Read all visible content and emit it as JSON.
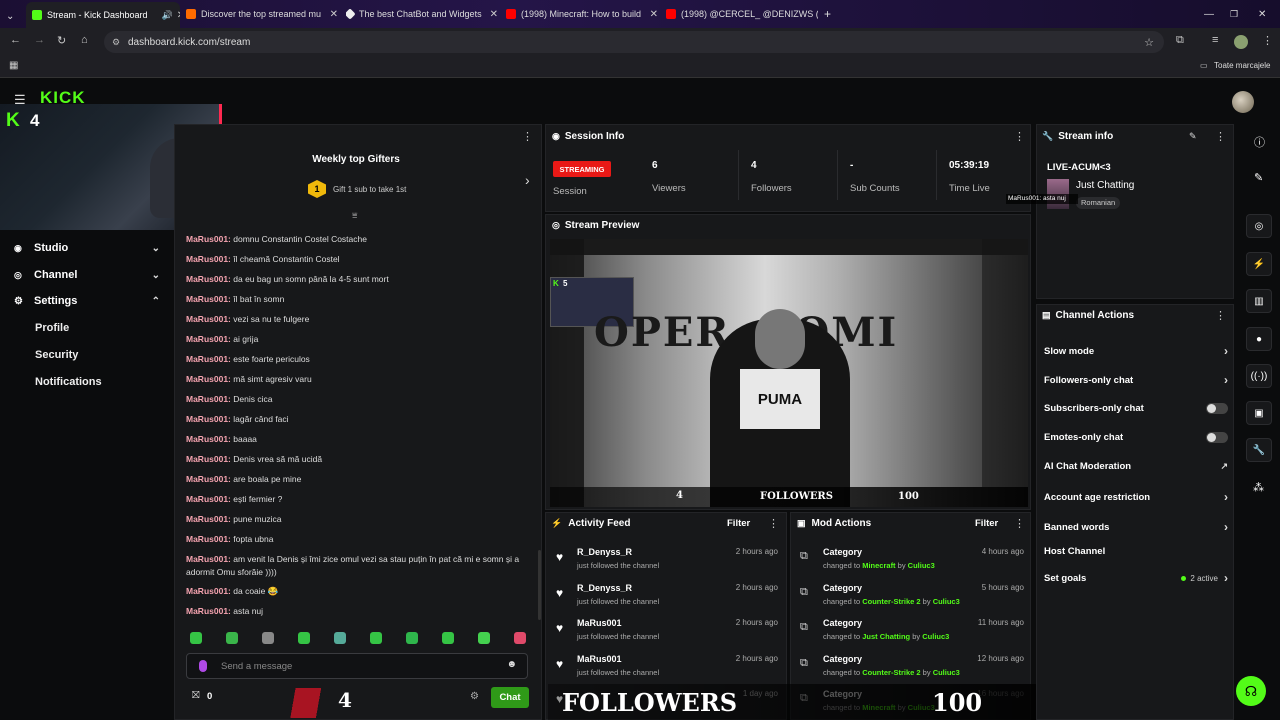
{
  "browser": {
    "tabs": [
      {
        "title": "Stream - Kick Dashboard",
        "color": "#53fc18",
        "active": true
      },
      {
        "title": "Discover the top streamed mu",
        "color": "#ff6a00"
      },
      {
        "title": "The best ChatBot and Widgets",
        "color": "#ffffff"
      },
      {
        "title": "(1998) Minecraft: How to build",
        "color": "#ff0000"
      },
      {
        "title": "(1998) @CERCEL_ @DENIZWS (",
        "color": "#ff0000"
      }
    ],
    "url": "dashboard.kick.com/stream",
    "bookmarks_label": "Toate marcajele"
  },
  "webcam": {
    "badge": "4"
  },
  "sidebar": {
    "items": [
      {
        "label": "Studio",
        "icon": "studio-icon"
      },
      {
        "label": "Channel",
        "icon": "channel-icon"
      },
      {
        "label": "Settings",
        "icon": "gear-icon"
      }
    ],
    "sub_items": [
      "Profile",
      "Security",
      "Notifications"
    ]
  },
  "chat": {
    "gifters_title": "Weekly top Gifters",
    "gifters_rank": "1",
    "gifters_text": "Gift 1 sub to take 1st",
    "messages": [
      {
        "user": "MaRus001:",
        "text": "domnu Constantin Costel Costache"
      },
      {
        "user": "MaRus001:",
        "text": "îl cheamă Constantin Costel"
      },
      {
        "user": "MaRus001:",
        "text": "da eu bag un somn până la 4-5 sunt mort"
      },
      {
        "user": "MaRus001:",
        "text": "îl bat în somn"
      },
      {
        "user": "MaRus001:",
        "text": "vezi sa nu te fulgere"
      },
      {
        "user": "MaRus001:",
        "text": "ai grija"
      },
      {
        "user": "MaRus001:",
        "text": "este foarte periculos"
      },
      {
        "user": "MaRus001:",
        "text": "mă simt agresiv varu"
      },
      {
        "user": "MaRus001:",
        "text": "Denis cica"
      },
      {
        "user": "MaRus001:",
        "text": "lagăr când faci"
      },
      {
        "user": "MaRus001:",
        "text": "baaaa"
      },
      {
        "user": "MaRus001:",
        "text": "Denis vrea să mă ucidă"
      },
      {
        "user": "MaRus001:",
        "text": "are boala pe mine"
      },
      {
        "user": "MaRus001:",
        "text": "ești fermier ?"
      },
      {
        "user": "MaRus001:",
        "text": "pune muzica"
      },
      {
        "user": "MaRus001:",
        "text": "fopta ubna"
      },
      {
        "user": "MaRus001:",
        "text": "am venit la Denis și îmi zice omul vezi sa stau puțin în pat că mi e somn și a adormit Omu sforăie ))))"
      },
      {
        "user": "MaRus001:",
        "text": "da coaie 😂"
      },
      {
        "user": "MaRus001:",
        "text": "asta nuj"
      }
    ],
    "input_placeholder": "Send a message",
    "points": "0",
    "chat_button": "Chat",
    "overlay_count": "4"
  },
  "session": {
    "title": "Session Info",
    "status_badge": "STREAMING",
    "stats": [
      {
        "value": "",
        "label": "Session"
      },
      {
        "value": "6",
        "label": "Viewers"
      },
      {
        "value": "4",
        "label": "Followers"
      },
      {
        "value": "-",
        "label": "Sub Counts"
      },
      {
        "value": "05:39:19",
        "label": "Time Live"
      }
    ]
  },
  "stream_info": {
    "title": "Stream info",
    "stream_title": "LIVE-ACUM<3",
    "category": "Just Chatting",
    "language": "Romanian",
    "chat_overlay": "MaRus001: asta nuj"
  },
  "preview": {
    "title": "Stream Preview",
    "overlay_left": "4",
    "overlay_label": "FOLLOWERS",
    "overlay_right": "100",
    "inner_badge": "5",
    "scene_text": "OPER    OMI",
    "hoodie_text": "PUMA"
  },
  "activity": {
    "title": "Activity Feed",
    "filter": "Filter",
    "items": [
      {
        "name": "R_Denyss_R",
        "desc": "just followed the channel",
        "time": "2 hours ago"
      },
      {
        "name": "R_Denyss_R",
        "desc": "just followed the channel",
        "time": "2 hours ago"
      },
      {
        "name": "MaRus001",
        "desc": "just followed the channel",
        "time": "2 hours ago"
      },
      {
        "name": "MaRus001",
        "desc": "just followed the channel",
        "time": "2 hours ago"
      },
      {
        "name": "",
        "desc": "",
        "time": "1 day ago"
      }
    ]
  },
  "mod_actions": {
    "title": "Mod Actions",
    "filter": "Filter",
    "items": [
      {
        "name": "Category",
        "pre": "changed to",
        "target": "Minecraft",
        "by": "by",
        "user": "Culiuc3",
        "time": "4 hours ago"
      },
      {
        "name": "Category",
        "pre": "changed to",
        "target": "Counter-Strike 2",
        "by": "by",
        "user": "Culiuc3",
        "time": "5 hours ago"
      },
      {
        "name": "Category",
        "pre": "changed to",
        "target": "Just Chatting",
        "by": "by",
        "user": "Culiuc3",
        "time": "11 hours ago"
      },
      {
        "name": "Category",
        "pre": "changed to",
        "target": "Counter-Strike 2",
        "by": "by",
        "user": "Culiuc3",
        "time": "12 hours ago"
      },
      {
        "name": "Category",
        "pre": "changed to",
        "target": "Minecraft",
        "by": "by",
        "user": "Culiuc3",
        "time": "16 hours ago"
      }
    ]
  },
  "bottom_overlay": {
    "left": "4",
    "label": "FOLLOWERS",
    "right": "100"
  },
  "channel_actions": {
    "title": "Channel Actions",
    "items": [
      {
        "label": "Slow mode",
        "kind": "chevron"
      },
      {
        "label": "Followers-only chat",
        "kind": "chevron"
      },
      {
        "label": "Subscribers-only chat",
        "kind": "toggle"
      },
      {
        "label": "Emotes-only chat",
        "kind": "toggle"
      },
      {
        "label": "AI Chat Moderation",
        "kind": "external"
      },
      {
        "label": "Account age restriction",
        "kind": "chevron"
      },
      {
        "label": "Banned words",
        "kind": "chevron"
      },
      {
        "label": "Host Channel",
        "kind": "none"
      },
      {
        "label": "Set goals",
        "kind": "chevron",
        "extra": "2 active"
      }
    ]
  },
  "colors": {
    "accent": "#53fc18",
    "streaming": "#e91916",
    "gold": "#f0b90b"
  }
}
